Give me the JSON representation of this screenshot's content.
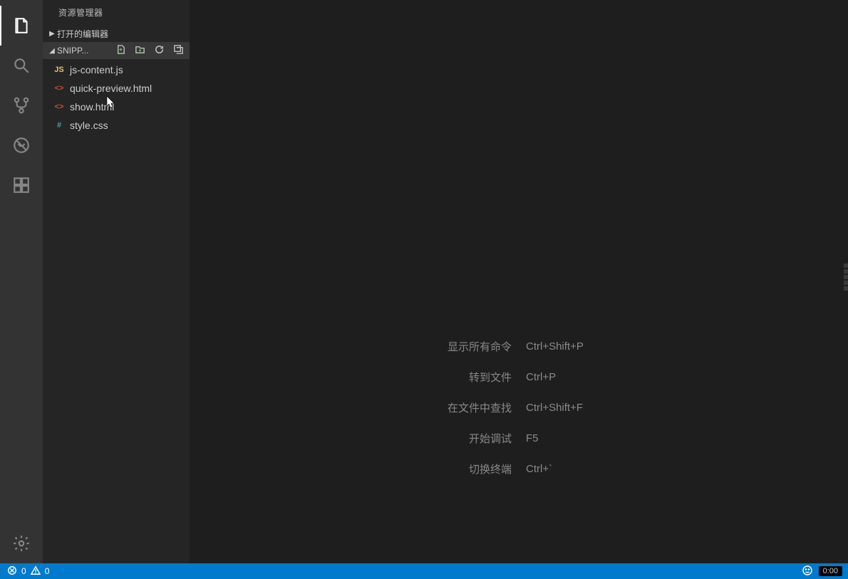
{
  "sidebar": {
    "title": "资源管理器",
    "openEditorsLabel": "打开的编辑器",
    "folderLabel": "SNIPP...",
    "files": [
      {
        "name": "js-content.js",
        "iconText": "JS",
        "iconClass": "ic-js"
      },
      {
        "name": "quick-preview.html",
        "iconText": "<>",
        "iconClass": "ic-html"
      },
      {
        "name": "show.html",
        "iconText": "<>",
        "iconClass": "ic-html"
      },
      {
        "name": "style.css",
        "iconText": "#",
        "iconClass": "ic-css"
      }
    ]
  },
  "hints": [
    {
      "label": "显示所有命令",
      "key": "Ctrl+Shift+P"
    },
    {
      "label": "转到文件",
      "key": "Ctrl+P"
    },
    {
      "label": "在文件中查找",
      "key": "Ctrl+Shift+F"
    },
    {
      "label": "开始调试",
      "key": "F5"
    },
    {
      "label": "切换终端",
      "key": "Ctrl+`"
    }
  ],
  "status": {
    "errors": "0",
    "warnings": "0",
    "time": "0:00"
  }
}
